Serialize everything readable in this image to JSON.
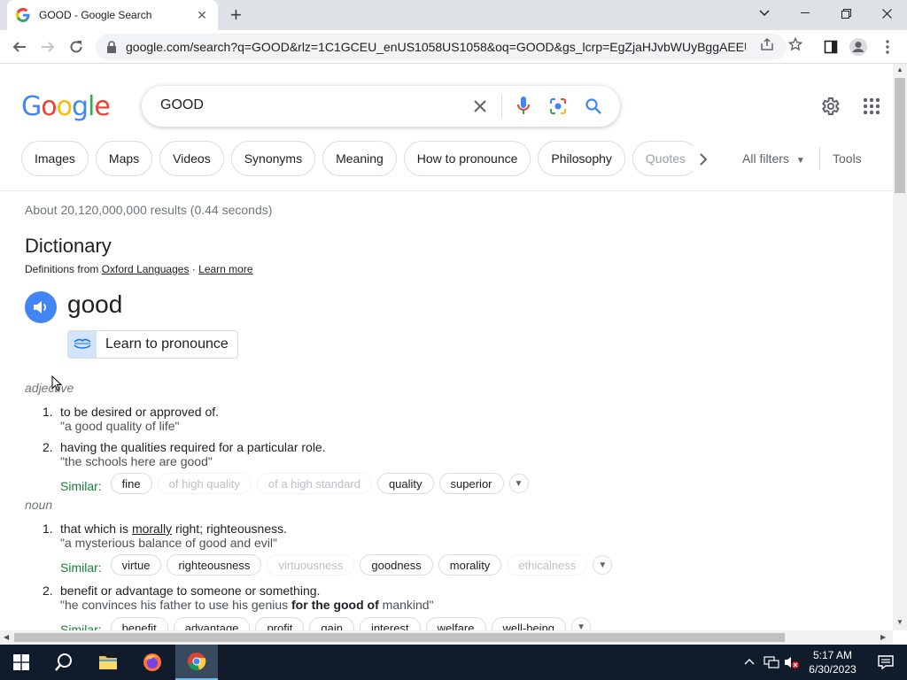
{
  "browser": {
    "tab_title": "GOOD - Google Search",
    "tab_close": "✕",
    "new_tab": "+",
    "url": "google.com/search?q=GOOD&rlz=1C1GCEU_enUS1058US1058&oq=GOOD&gs_lcrp=EgZjaHJvbWUyBggAEEUY..."
  },
  "google": {
    "logo": [
      "G",
      "o",
      "o",
      "g",
      "l",
      "e"
    ],
    "logo_colors": [
      "#4285f4",
      "#ea4335",
      "#fbbc05",
      "#4285f4",
      "#34a853",
      "#ea4335"
    ],
    "query": "GOOD"
  },
  "chips": [
    "Images",
    "Maps",
    "Videos",
    "Synonyms",
    "Meaning",
    "How to pronounce",
    "Philosophy",
    "Quotes"
  ],
  "filters": {
    "all_filters": "All filters",
    "tools": "Tools"
  },
  "results": {
    "stats": "About 20,120,000,000 results (0.44 seconds)",
    "dictionary_title": "Dictionary",
    "definitions_from": "Definitions from",
    "source": "Oxford Languages",
    "separator": " · ",
    "learn_more": "Learn more",
    "word": "good",
    "learn_to_pronounce": "Learn to pronounce"
  },
  "dictionary": {
    "adjective": {
      "pos": "adjective",
      "defs": [
        {
          "num": "1.",
          "text": "to be desired or approved of.",
          "example": "\"a good quality of life\""
        },
        {
          "num": "2.",
          "text": "having the qualities required for a particular role.",
          "example": "\"the schools here are good\""
        }
      ],
      "similar_label": "Similar:",
      "similar": [
        "fine",
        "of high quality",
        "of a high standard",
        "quality",
        "superior"
      ]
    },
    "noun": {
      "pos": "noun",
      "def1": {
        "num": "1.",
        "pre": "that which is ",
        "link": "morally",
        "post": " right; righteousness.",
        "example": "\"a mysterious balance of good and evil\""
      },
      "similar_label": "Similar:",
      "similar1": [
        "virtue",
        "righteousness",
        "virtuousness",
        "goodness",
        "morality",
        "ethicalness"
      ],
      "def2": {
        "num": "2.",
        "text": "benefit or advantage to someone or something.",
        "ex_pre": "\"he convinces his father to use his genius ",
        "ex_bold": "for the good of",
        "ex_post": " mankind\""
      },
      "similar2": [
        "benefit",
        "advantage",
        "profit",
        "gain",
        "interest",
        "welfare",
        "well-being"
      ]
    }
  },
  "taskbar": {
    "time": "5:17 AM",
    "date": "6/30/2023"
  },
  "colors": {
    "accent": "#4285f4",
    "taskbar": "#101c2c",
    "similar_label": "#188038"
  }
}
